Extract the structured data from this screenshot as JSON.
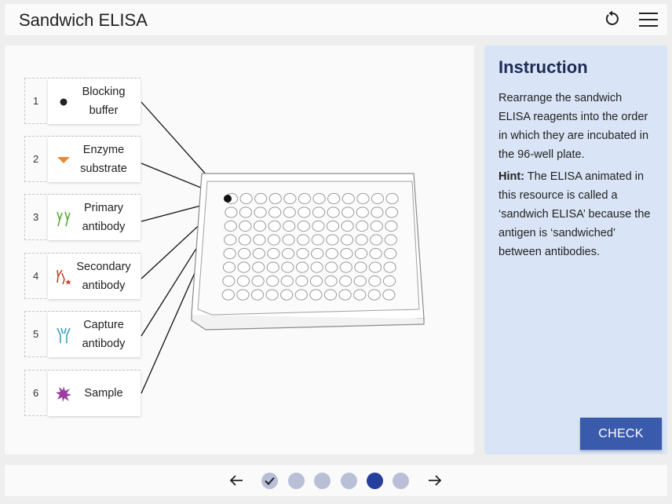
{
  "header": {
    "title": "Sandwich ELISA",
    "reset_icon": "reset-icon",
    "menu_icon": "hamburger-menu-icon"
  },
  "slots": [
    {
      "number": "1",
      "label": "Blocking buffer",
      "icon": "dot-icon"
    },
    {
      "number": "2",
      "label": "Enzyme substrate",
      "icon": "triangle-icon"
    },
    {
      "number": "3",
      "label": "Primary antibody",
      "icon": "primary-antibody-icon"
    },
    {
      "number": "4",
      "label": "Secondary antibody",
      "icon": "secondary-antibody-icon"
    },
    {
      "number": "5",
      "label": "Capture antibody",
      "icon": "capture-antibody-icon"
    },
    {
      "number": "6",
      "label": "Sample",
      "icon": "sample-star-icon"
    }
  ],
  "instruction": {
    "title": "Instruction",
    "body": "Rearrange the sandwich ELISA reagents into the order in which they are incubated in the 96-well plate.",
    "hint_label": "Hint:",
    "hint_text": " The ELISA animated in this resource is called a ‘sandwich ELISA’ because the antigen is ‘sandwiched’ between antibodies."
  },
  "check_button": "CHECK",
  "nav": {
    "dots": [
      "completed",
      "pending",
      "pending",
      "pending",
      "current",
      "pending"
    ],
    "prev_icon": "arrow-left-icon",
    "next_icon": "arrow-right-icon"
  },
  "colors": {
    "accent": "#3a5aab",
    "current_dot": "#263f9d",
    "pending_dot": "#b9bfd7",
    "instruction_bg": "#d9e5f6",
    "substrate": "#e8883a",
    "primary_ab": "#5aab3c",
    "secondary_ab": "#c9432c",
    "capture_ab": "#3b9cc2",
    "sample": "#9b3f9e"
  }
}
